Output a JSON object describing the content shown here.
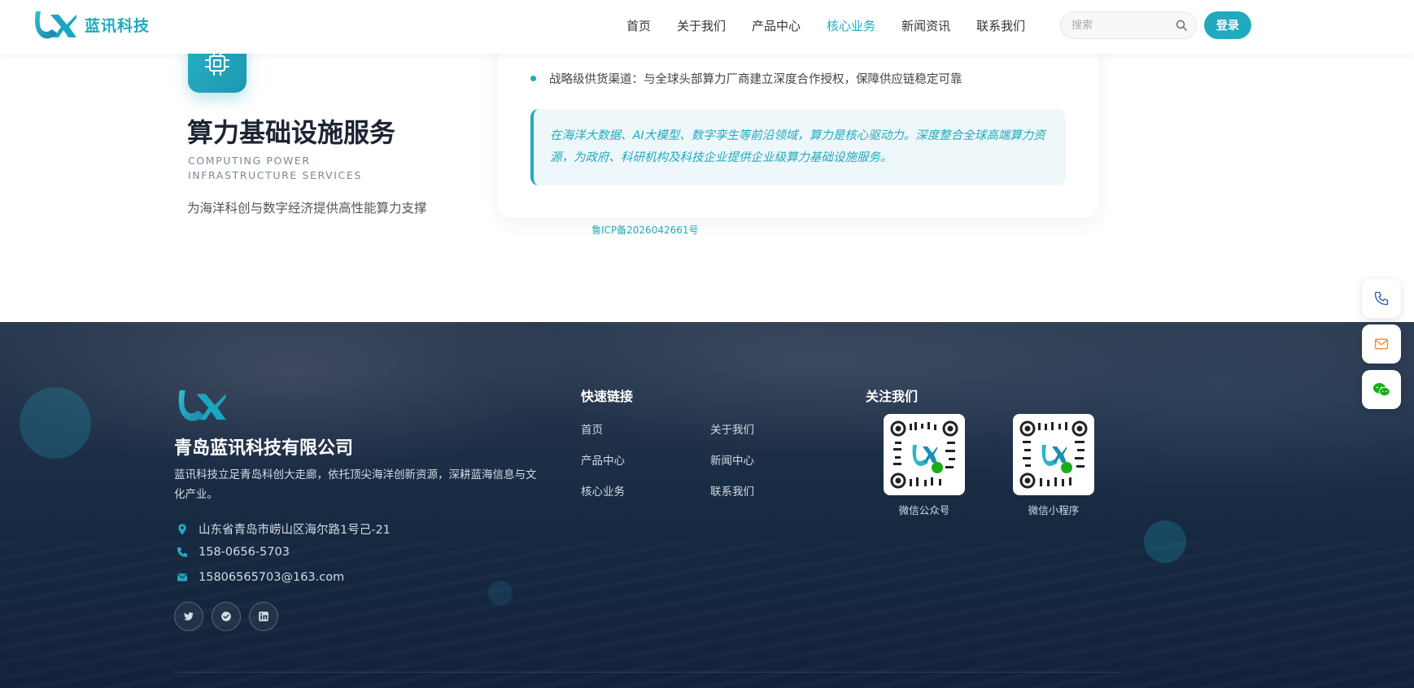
{
  "header": {
    "brand": "蓝讯科技",
    "nav": [
      {
        "label": "首页",
        "active": false
      },
      {
        "label": "关于我们",
        "active": false
      },
      {
        "label": "产品中心",
        "active": false
      },
      {
        "label": "核心业务",
        "active": true
      },
      {
        "label": "新闻资讯",
        "active": false
      },
      {
        "label": "联系我们",
        "active": false
      }
    ],
    "search_placeholder": "搜索",
    "login_label": "登录"
  },
  "service": {
    "icon": "chip-icon",
    "title": "算力基础设施服务",
    "subtitle_en": "COMPUTING POWER INFRASTRUCTURE SERVICES",
    "description": "为海洋科创与数字经济提供高性能算力支撑",
    "bullet": "战略级供货渠道：与全球头部算力厂商建立深度合作授权，保障供应链稳定可靠",
    "quote": "在海洋大数据、AI大模型、数字孪生等前沿领域，算力是核心驱动力。深度整合全球高端算力资源，为政府、科研机构及科技企业提供企业级算力基础设施服务。"
  },
  "icp": "鲁ICP备2026042661号",
  "float_buttons": [
    "phone-icon",
    "mail-icon",
    "wechat-icon"
  ],
  "footer": {
    "company": "青岛蓝讯科技有限公司",
    "about": "蓝讯科技立足青岛科创大走廊，依托顶尖海洋创新资源，深耕蓝海信息与文化产业。",
    "address": "山东省青岛市崂山区海尔路1号己-21",
    "phone": "158-0656-5703",
    "email": "15806565703@163.com",
    "social": [
      "twitter-icon",
      "verified-icon",
      "linkedin-icon"
    ],
    "quick_links_title": "快速链接",
    "quick_links": [
      "首页",
      "关于我们",
      "产品中心",
      "新闻中心",
      "核心业务",
      "联系我们"
    ],
    "follow_title": "关注我们",
    "qr_codes": [
      {
        "label": "微信公众号"
      },
      {
        "label": "微信小程序"
      }
    ]
  },
  "colors": {
    "accent": "#21a9c0",
    "footer_bg": "#172a42",
    "title": "#1d2433"
  }
}
